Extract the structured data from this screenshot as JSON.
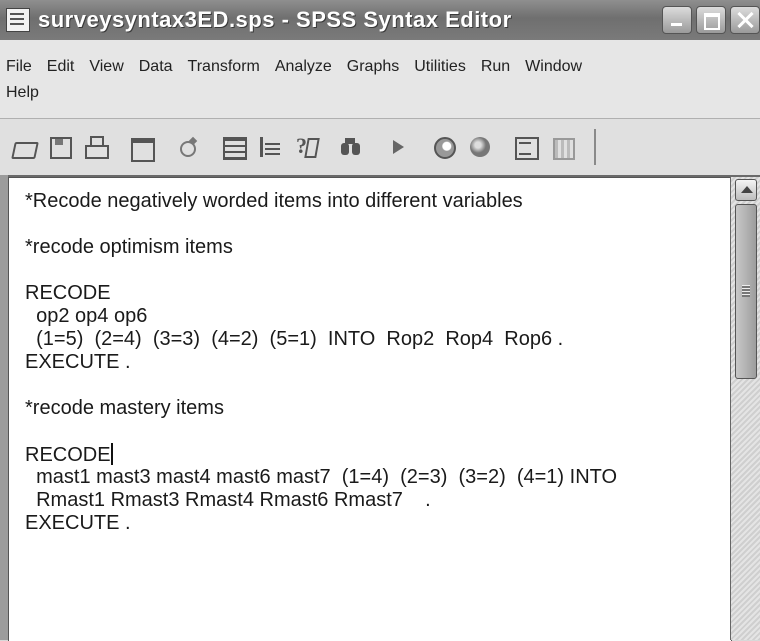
{
  "window": {
    "title": "surveysyntax3ED.sps - SPSS Syntax Editor"
  },
  "menu": {
    "items": [
      "File",
      "Edit",
      "View",
      "Data",
      "Transform",
      "Analyze",
      "Graphs",
      "Utilities",
      "Run",
      "Window",
      "Help"
    ]
  },
  "toolbar": {
    "icons": [
      "open-icon",
      "save-icon",
      "print-icon",
      "dialog-recall-icon",
      "goto-case-icon",
      "variables-icon",
      "select-cases-icon",
      "help-icon",
      "find-icon",
      "run-icon",
      "script-icon",
      "spss-icon",
      "split-file-icon",
      "syntax-help-icon"
    ]
  },
  "editor": {
    "lines": [
      "*Recode negatively worded items into different variables",
      "",
      "*recode optimism items",
      "",
      "RECODE",
      "  op2 op4 op6",
      "  (1=5)  (2=4)  (3=3)  (4=2)  (5=1)  INTO  Rop2  Rop4  Rop6 .",
      "EXECUTE .",
      "",
      "*recode mastery items",
      "",
      "RECODE",
      "  mast1 mast3 mast4 mast6 mast7  (1=4)  (2=3)  (3=2)  (4=1) INTO",
      "  Rmast1 Rmast3 Rmast4 Rmast6 Rmast7    .",
      "EXECUTE ."
    ]
  }
}
